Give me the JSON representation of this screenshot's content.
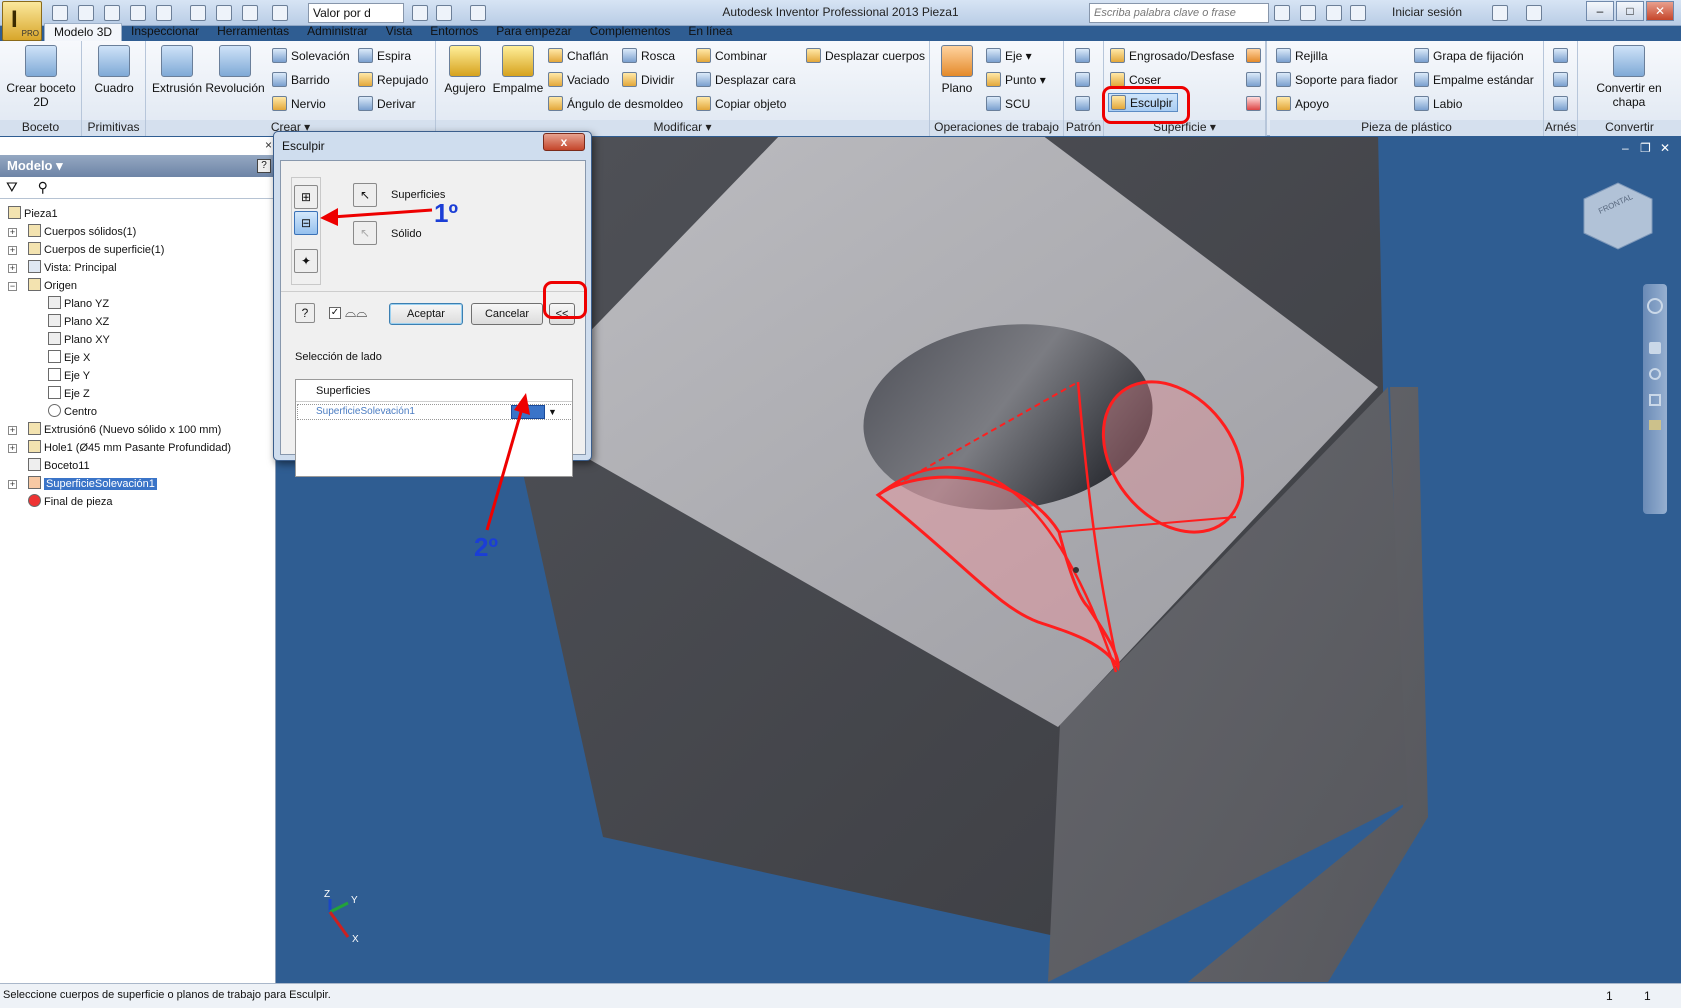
{
  "window": {
    "title": "Autodesk Inventor Professional 2013    Pieza1",
    "appearance_value": "Valor por d",
    "search_placeholder": "Escriba palabra clave o frase",
    "signin": "Iniciar sesión",
    "app_badge": "PRO"
  },
  "tabs": [
    "Modelo 3D",
    "Inspeccionar",
    "Herramientas",
    "Administrar",
    "Vista",
    "Entornos",
    "Para empezar",
    "Complementos",
    "En línea"
  ],
  "ribbon": {
    "boceto": {
      "title": "Boceto",
      "btn": "Crear boceto 2D"
    },
    "primitivas": {
      "title": "Primitivas",
      "btn": "Cuadro"
    },
    "crear": {
      "title": "Crear",
      "extrusion": "Extrusión",
      "revolucion": "Revolución",
      "small": [
        "Solevación",
        "Barrido",
        "Nervio",
        "Espira",
        "Repujado",
        "Derivar"
      ]
    },
    "modificar": {
      "title": "Modificar",
      "agujero": "Agujero",
      "empalme": "Empalme",
      "col1": [
        "Chaflán",
        "Vaciado",
        "Ángulo de desmoldeo"
      ],
      "col2": [
        "Rosca",
        "Dividir"
      ],
      "col3": [
        "Combinar",
        "Desplazar cara",
        "Copiar objeto"
      ],
      "col4": [
        "Desplazar cuerpos"
      ]
    },
    "operaciones": {
      "title": "Operaciones de trabajo",
      "plano": "Plano",
      "small": [
        "Eje",
        "Punto",
        "SCU"
      ]
    },
    "patron": {
      "title": "Patrón"
    },
    "superficie": {
      "title": "Superficie",
      "items": [
        "Engrosado/Desfase",
        "Coser",
        "Esculpir"
      ]
    },
    "plastico": {
      "title": "Pieza de plástico",
      "col1": [
        "Rejilla",
        "Soporte para fiador",
        "Apoyo"
      ],
      "col2": [
        "Grapa de fijación",
        "Empalme estándar",
        "Labio"
      ]
    },
    "arnes": {
      "title": "Arnés"
    },
    "convertir": {
      "title": "Convertir",
      "btn": "Convertir en chapa"
    }
  },
  "browser": {
    "header": "Modelo",
    "nodes": [
      {
        "label": "Pieza1"
      },
      {
        "label": "Cuerpos sólidos(1)"
      },
      {
        "label": "Cuerpos de superficie(1)"
      },
      {
        "label": "Vista: Principal"
      },
      {
        "label": "Origen"
      },
      {
        "label": "Plano YZ"
      },
      {
        "label": "Plano XZ"
      },
      {
        "label": "Plano XY"
      },
      {
        "label": "Eje X"
      },
      {
        "label": "Eje Y"
      },
      {
        "label": "Eje Z"
      },
      {
        "label": "Centro"
      },
      {
        "label": "Extrusión6 (Nuevo sólido x 100 mm)"
      },
      {
        "label": "Hole1 (Ø45 mm Pasante Profundidad)"
      },
      {
        "label": "Boceto11"
      },
      {
        "label": "SuperficieSolevación1"
      },
      {
        "label": "Final de pieza"
      }
    ]
  },
  "dialog": {
    "title": "Esculpir",
    "superficies": "Superficies",
    "solido": "Sólido",
    "aceptar": "Aceptar",
    "cancelar": "Cancelar",
    "more": "<<",
    "close": "x",
    "side_section": "Selección de lado",
    "grid_header": "Superficies",
    "grid_row": "SuperficieSolevación1"
  },
  "annotations": {
    "first": "1º",
    "second": "2º"
  },
  "viewcube": "FRONTAL",
  "axes": {
    "x": "X",
    "y": "Y",
    "z": "Z"
  },
  "status": {
    "message": "Seleccione cuerpos de superficie o planos de trabajo para Esculpir.",
    "count1": "1",
    "count2": "1"
  },
  "colors": {
    "viewport_bg": "#2f5d92",
    "highlight": "#e00000",
    "annotation_blue": "#1b3ed6"
  }
}
